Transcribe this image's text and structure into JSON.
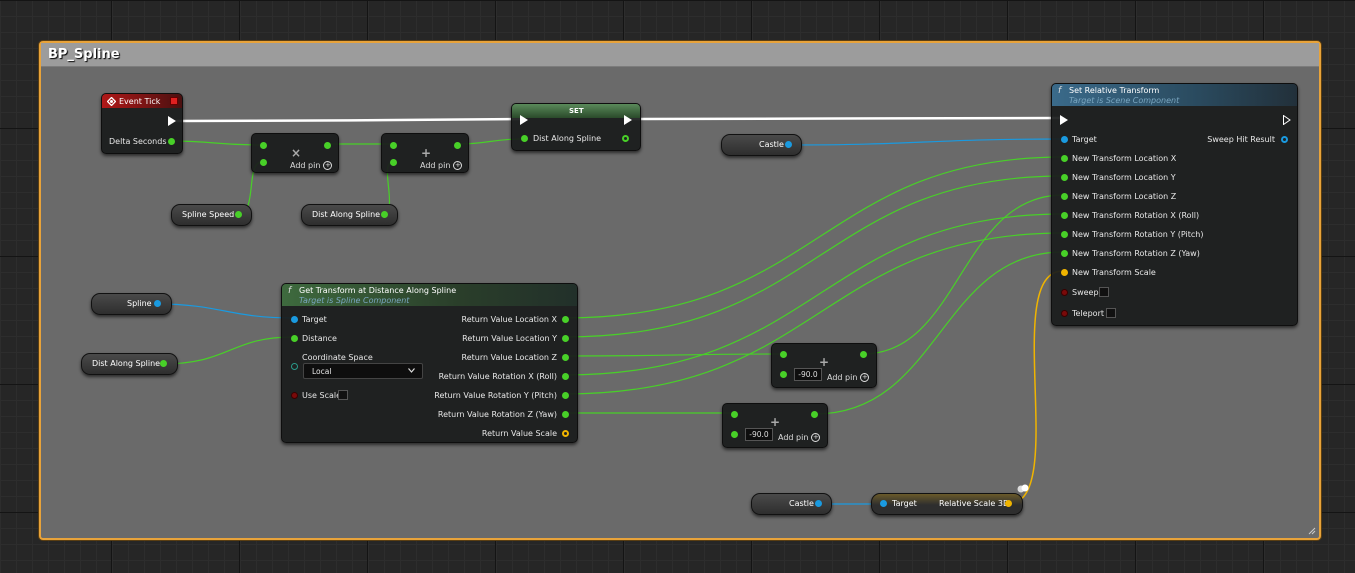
{
  "comment": {
    "title": "BP_Spline",
    "color": "#e8a33a"
  },
  "event_tick": {
    "title": "Event Tick",
    "delta_seconds": "Delta Seconds"
  },
  "multiply_node": {
    "operator": "×",
    "add_pin": "Add pin"
  },
  "add_node_1": {
    "operator": "+",
    "add_pin": "Add pin"
  },
  "set_node": {
    "title": "SET",
    "pin": "Dist Along Spline"
  },
  "var_spline_speed": "Spline Speed",
  "var_dist_along_spline_top": "Dist Along Spline",
  "var_castle_top": "Castle",
  "var_spline": "Spline",
  "var_dist_along_spline_bottom": "Dist Along Spline",
  "var_castle_bottom": "Castle",
  "get_transform": {
    "title": "Get Transform at Distance Along Spline",
    "subtitle": "Target is Spline Component",
    "inputs": {
      "target": "Target",
      "distance": "Distance",
      "coordinate_space": "Coordinate Space",
      "coordinate_value": "Local",
      "use_scale": "Use Scale"
    },
    "outputs": [
      "Return Value Location X",
      "Return Value Location Y",
      "Return Value Location Z",
      "Return Value Rotation X (Roll)",
      "Return Value Rotation Y (Pitch)",
      "Return Value Rotation Z (Yaw)",
      "Return Value Scale"
    ]
  },
  "add_node_2": {
    "value": "-90.0",
    "operator": "+",
    "add_pin": "Add pin"
  },
  "add_node_3": {
    "value": "-90.0",
    "operator": "+",
    "add_pin": "Add pin"
  },
  "relative_scale": {
    "target": "Target",
    "output": "Relative Scale 3D"
  },
  "set_relative_transform": {
    "title": "Set Relative Transform",
    "subtitle": "Target is Scene Component",
    "target": "Target",
    "sweep_hit": "Sweep Hit Result",
    "inputs": [
      "New Transform Location X",
      "New Transform Location Y",
      "New Transform Location Z",
      "New Transform Rotation X (Roll)",
      "New Transform Rotation Y (Pitch)",
      "New Transform Rotation Z (Yaw)",
      "New Transform Scale"
    ],
    "sweep": "Sweep",
    "teleport": "Teleport"
  },
  "colors": {
    "exec": "#ffffff",
    "float": "#48d028",
    "object": "#1a9ae0",
    "struct": "#f0b400",
    "bool": "#7a0a0a"
  }
}
